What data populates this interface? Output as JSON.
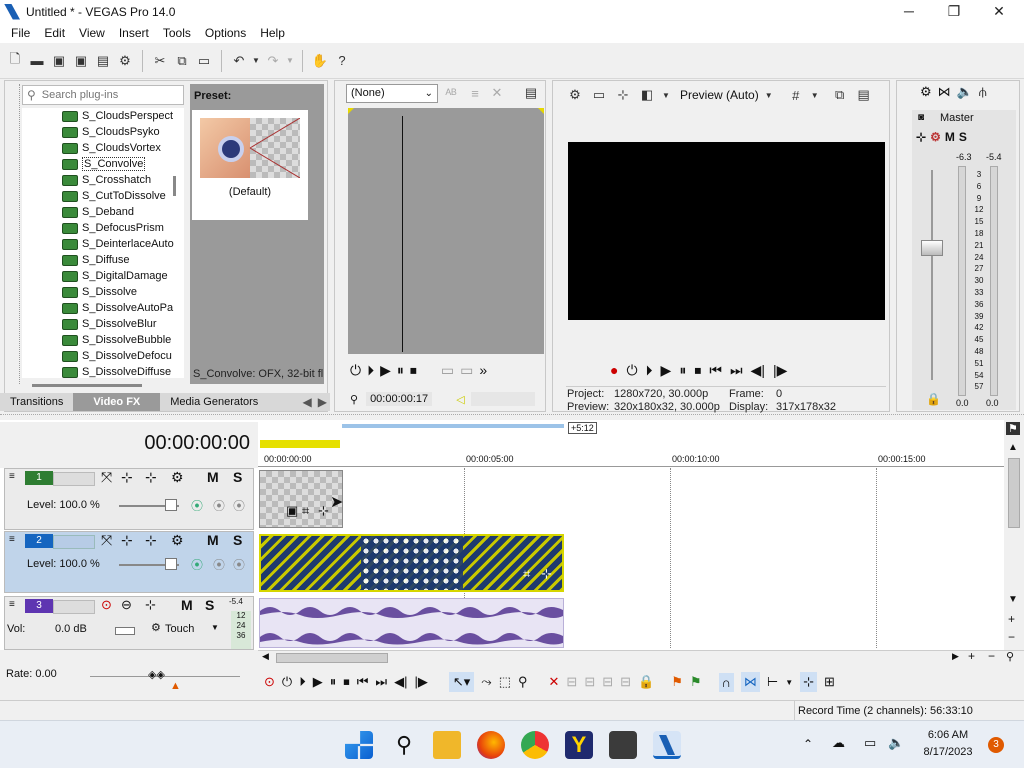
{
  "window": {
    "title": "Untitled * - VEGAS Pro 14.0",
    "minimize": "─",
    "maximize": "❐",
    "close": "✕"
  },
  "menu": [
    "File",
    "Edit",
    "View",
    "Insert",
    "Tools",
    "Options",
    "Help"
  ],
  "plugins": {
    "search_placeholder": "Search plug-ins",
    "items": [
      "S_CloudsPerspect",
      "S_CloudsPsyko",
      "S_CloudsVortex",
      "S_Convolve",
      "S_Crosshatch",
      "S_CutToDissolve",
      "S_Deband",
      "S_DefocusPrism",
      "S_DeinterlaceAuto",
      "S_Diffuse",
      "S_DigitalDamage",
      "S_Dissolve",
      "S_DissolveAutoPa",
      "S_DissolveBlur",
      "S_DissolveBubble",
      "S_DissolveDefocu",
      "S_DissolveDiffuse"
    ],
    "selected_index": 3,
    "preset_label": "Preset:",
    "preset_name": "(Default)",
    "description": "S_Convolve: OFX, 32-bit fl",
    "tabs": [
      "Transitions",
      "Video FX",
      "Media Generators"
    ],
    "active_tab": "Video FX"
  },
  "trimmer": {
    "dropdown": "(None)",
    "timecode": "00:00:00:17"
  },
  "preview": {
    "mode": "Preview (Auto)",
    "project_label": "Project:",
    "project_value": "1280x720, 30.000p",
    "preview_label": "Preview:",
    "preview_value": "320x180x32, 30.000p",
    "frame_label": "Frame:",
    "frame_value": "0",
    "display_label": "Display:",
    "display_value": "317x178x32"
  },
  "master": {
    "label": "Master",
    "left_peak": "-6.3",
    "right_peak": "-5.4",
    "scale": [
      "3",
      "6",
      "9",
      "12",
      "15",
      "18",
      "21",
      "24",
      "27",
      "30",
      "33",
      "36",
      "39",
      "42",
      "45",
      "48",
      "51",
      "54",
      "57"
    ],
    "left_val": "0.0",
    "right_val": "0.0"
  },
  "timeline": {
    "timecode": "00:00:00:00",
    "ruler": [
      "00:00:00:00",
      "00:00:05:00",
      "00:00:10:00",
      "00:00:15:00"
    ],
    "region_label": "+5:12",
    "tracks": [
      {
        "num": "1",
        "level": "Level: 100.0 %",
        "m": "M",
        "s": "S"
      },
      {
        "num": "2",
        "level": "Level: 100.0 %",
        "m": "M",
        "s": "S"
      },
      {
        "num": "3",
        "vol_label": "Vol:",
        "vol_value": "0.0 dB",
        "mode": "Touch",
        "m": "M",
        "s": "S",
        "meter_top": "-5.4",
        "meter_scale": [
          "12",
          "24",
          "36"
        ]
      }
    ],
    "rate": "Rate: 0.00",
    "record_time": "Record Time (2 channels): 56:33:10"
  },
  "taskbar": {
    "time": "6:06 AM",
    "date": "8/17/2023",
    "notif_count": "3"
  }
}
